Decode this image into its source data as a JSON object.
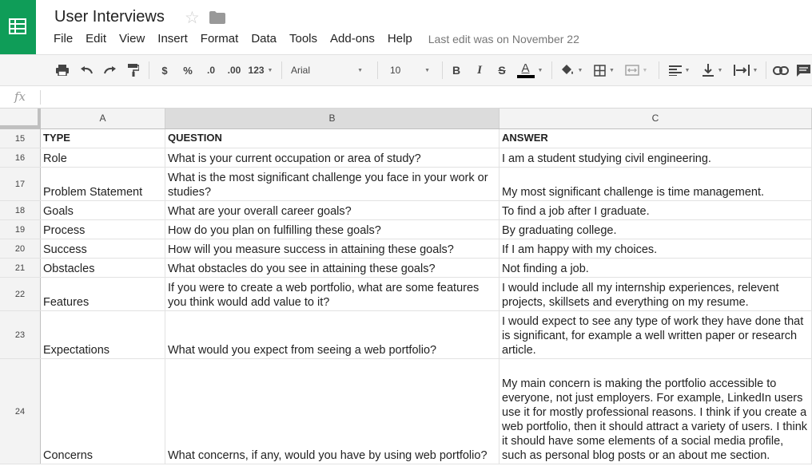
{
  "app": {
    "title": "User Interviews",
    "icons": {
      "logo": "sheets-logo-icon",
      "star": "star-icon",
      "folder": "folder-icon"
    },
    "accent_color": "#0f9d58"
  },
  "menu": {
    "items": [
      "File",
      "Edit",
      "View",
      "Insert",
      "Format",
      "Data",
      "Tools",
      "Add-ons",
      "Help"
    ],
    "last_edit": "Last edit was on November 22"
  },
  "toolbar": {
    "currency": "$",
    "percent": "%",
    "decrease_decimal": ".0",
    "increase_decimal": ".00",
    "number_format": "123",
    "font": "Arial",
    "font_size": "10",
    "bold": "B",
    "italic": "I",
    "strikethrough": "S",
    "text_color": "A"
  },
  "formula_bar": {
    "label": "fx",
    "value": ""
  },
  "sheet": {
    "columns": [
      "A",
      "B",
      "C"
    ],
    "rows": [
      {
        "num": "15",
        "a": "TYPE",
        "b": "QUESTION",
        "c": "ANSWER"
      },
      {
        "num": "16",
        "a": "Role",
        "b": "What is your current occupation or area of study?",
        "c": "I am a student studying civil engineering."
      },
      {
        "num": "17",
        "a": "Problem Statement",
        "b": "What is the most significant challenge you face in your work or studies?",
        "c": "My most significant challenge is time management."
      },
      {
        "num": "18",
        "a": "Goals",
        "b": "What are your overall career goals?",
        "c": "To find a job after I graduate."
      },
      {
        "num": "19",
        "a": "Process",
        "b": "How do you plan on fulfilling these goals?",
        "c": "By graduating college."
      },
      {
        "num": "20",
        "a": "Success",
        "b": "How will you measure success in attaining these goals?",
        "c": "If I am happy with my choices."
      },
      {
        "num": "21",
        "a": "Obstacles",
        "b": "What obstacles do you see in attaining these goals?",
        "c": "Not finding a job."
      },
      {
        "num": "22",
        "a": "Features",
        "b": "If you were to create a web portfolio, what are some features you think would add value to it?",
        "c": "I would include all my internship experiences, relevent projects, skillsets and everything on my resume."
      },
      {
        "num": "23",
        "a": "Expectations",
        "b": "What would you expect from seeing a web portfolio?",
        "c": "I would expect to see any type of work they have done that is significant, for example a well written paper or research article."
      },
      {
        "num": "24",
        "a": "Concerns",
        "b": "What concerns, if any, would you have by using web portfolio?",
        "c": "My main concern is making the portfolio accessible to everyone, not just employers. For example, LinkedIn users use it for mostly professional reasons. I think if you create a web portfolio, then it should attract a variety of users. I think it should have some elements of a social media profile, such as personal blog posts or an about me section."
      }
    ]
  }
}
